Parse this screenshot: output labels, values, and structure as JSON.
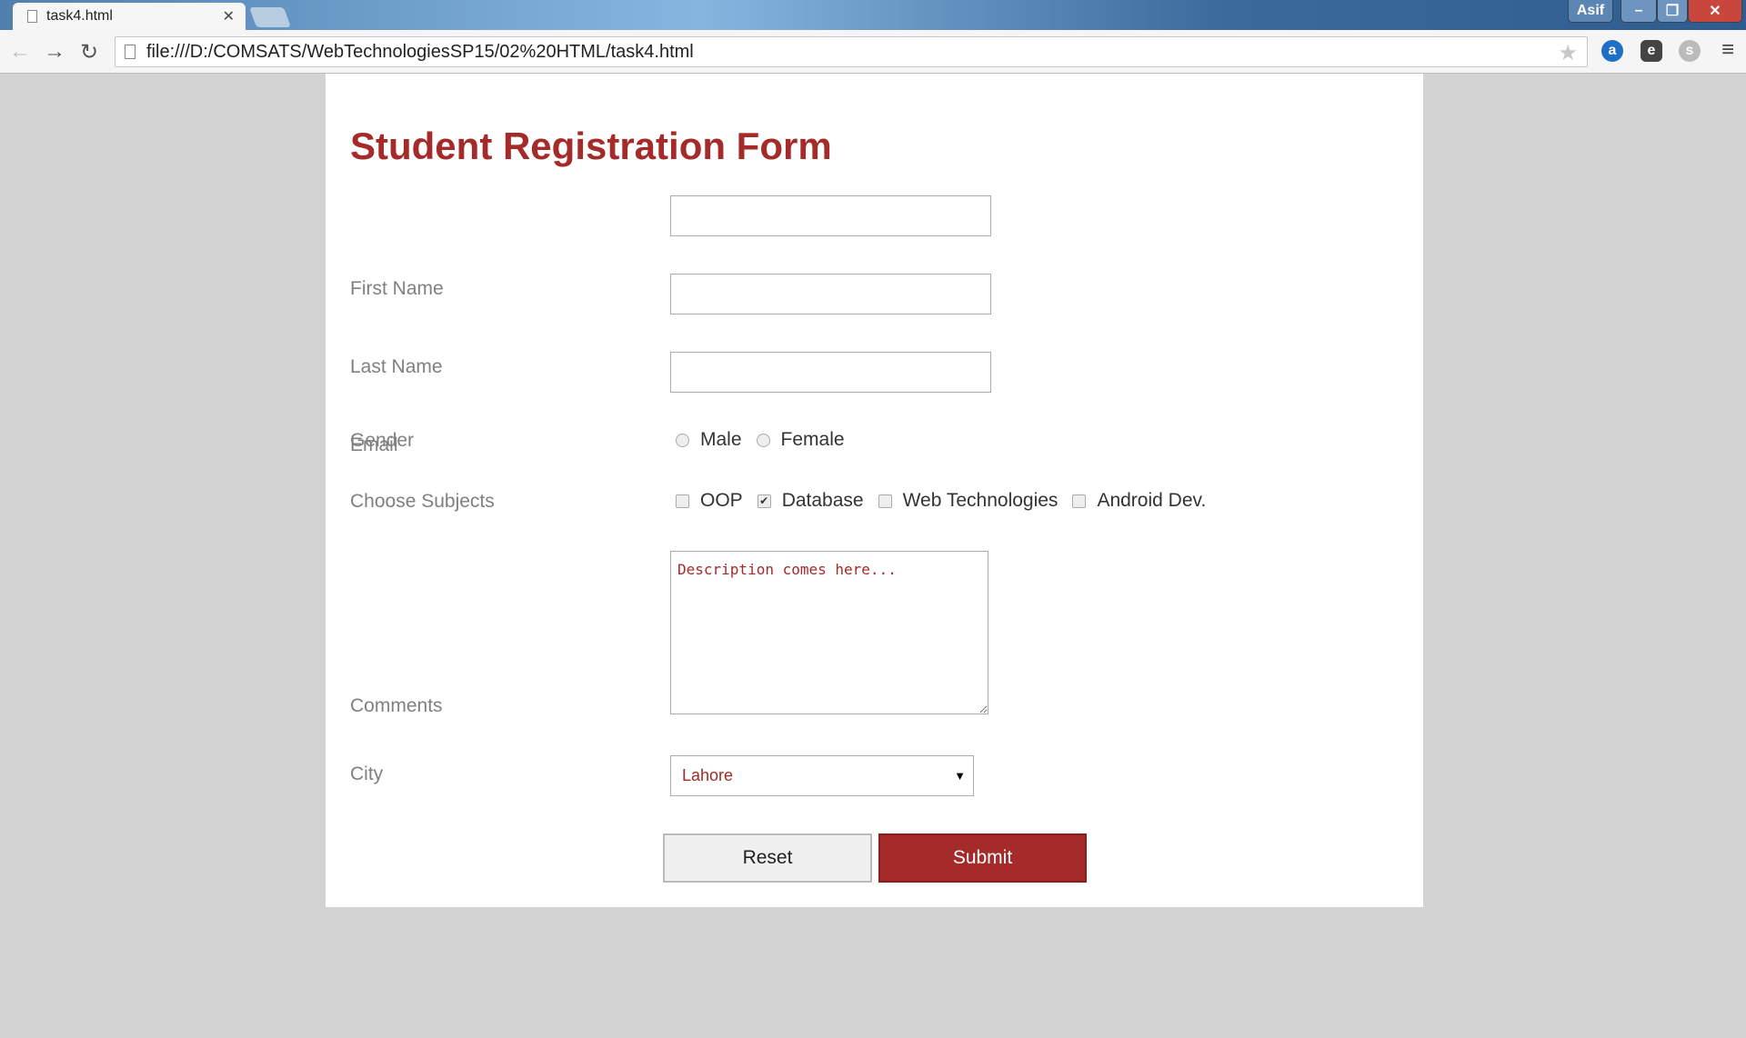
{
  "browser": {
    "tab_title": "task4.html",
    "url": "file:///D:/COMSATS/WebTechnologiesSP15/02%20HTML/task4.html",
    "user": "Asif"
  },
  "form": {
    "title": "Student Registration Form",
    "first_name_label": "First Name",
    "last_name_label": "Last Name",
    "email_label": "Email",
    "gender_label": "Gender",
    "gender_options": [
      "Male",
      "Female"
    ],
    "subjects_label": "Choose Subjects",
    "subjects": [
      {
        "label": "OOP",
        "checked": false
      },
      {
        "label": "Database",
        "checked": true
      },
      {
        "label": "Web Technologies",
        "checked": false
      },
      {
        "label": "Android Dev.",
        "checked": false
      }
    ],
    "comments_label": "Comments",
    "comments_placeholder": "Description comes here...",
    "city_label": "City",
    "city_value": "Lahore",
    "reset_label": "Reset",
    "submit_label": "Submit"
  },
  "colors": {
    "accent": "#a52a2a",
    "label": "#808080"
  }
}
